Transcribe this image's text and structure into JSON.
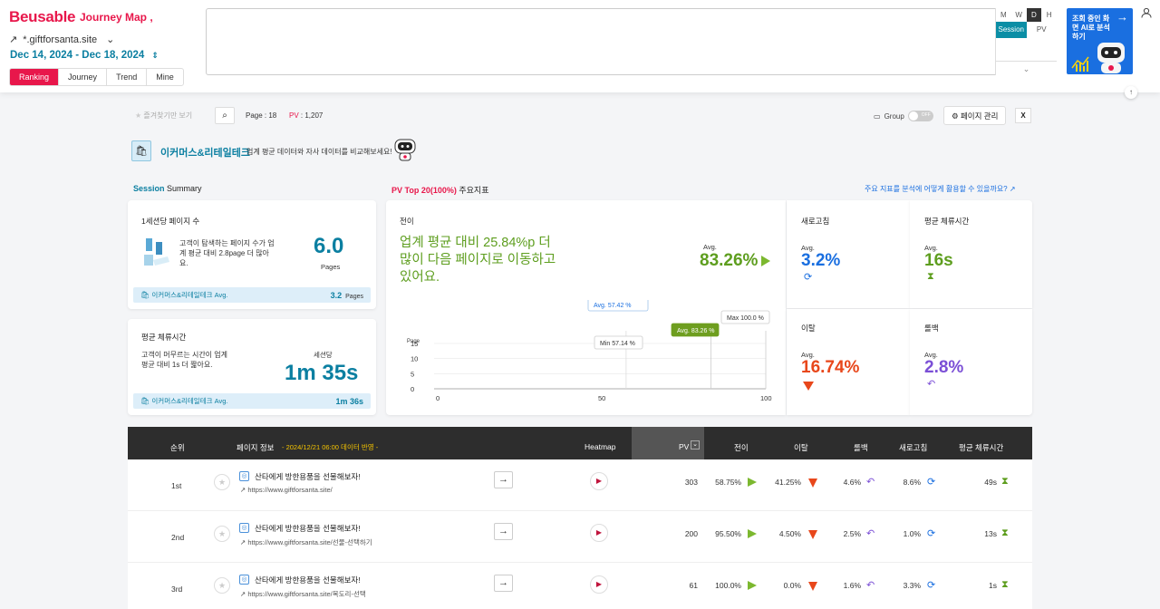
{
  "header": {
    "logo": "Beusable",
    "logo_sub": "Journey Map",
    "site": "*.giftforsanta.site",
    "date_range": "Dec 14, 2024 - Dec 18, 2024",
    "tabs": [
      "Ranking",
      "Journey",
      "Trend",
      "Mine"
    ],
    "granularity": [
      "M",
      "W",
      "D",
      "H"
    ],
    "metrics": [
      "Session",
      "PV"
    ],
    "ai_ad": "조회 중인 화면 AI로 분석하기"
  },
  "toolbar": {
    "favorites": "즐겨찾기만 보기",
    "page": "Page : 18",
    "pv_label": "PV",
    "pv_value": ": 1,207",
    "group": "Group",
    "toggle": "OFF",
    "manage": "페이지 관리",
    "excel": "X"
  },
  "industry": {
    "title": "이커머스&리테일테크",
    "desc": "업계 평균 데이터와 자사 데이터를 비교해보세요!"
  },
  "summary": {
    "label_a": "Session",
    "label_b": "Summary",
    "pv_top_a": "PV Top 20(100%)",
    "pv_top_b": "주요지표",
    "help": "주요 지표를 분석에 어떻게 활용할 수 있을까요?"
  },
  "pages_card": {
    "title": "1세션당 페이지 수",
    "desc": "고객이 탐색하는 페이지 수가 업계 평균 대비 2.8page 더 많아요.",
    "value": "6.0",
    "unit": "Pages",
    "avg_label": "이커머스&리테일테크 Avg.",
    "avg_value": "3.2",
    "avg_unit": "Pages"
  },
  "stay_card": {
    "title": "평균 체류시간",
    "desc": "고객이 머무르는 시간이 업계 평균 대비 1s 더 짧아요.",
    "sublabel": "세션당",
    "value": "1m 35s",
    "avg_label": "이커머스&리테일테크 Avg.",
    "avg_value": "1m 36s"
  },
  "transition": {
    "title": "전이",
    "headline": "업계 평균 대비 25.84%p 더 많이 다음 페이지로 이동하고 있어요.",
    "avg_label": "Avg.",
    "avg_value": "83.26%",
    "tip_avg": "Avg. 57.42 %",
    "tip_avg2": "Avg. 83.26 %",
    "tip_min": "Min 57.14 %",
    "tip_max": "Max 100.0 %"
  },
  "chart_data": {
    "type": "bar",
    "ylabel": "Page",
    "yticks": [
      "15",
      "10",
      "5",
      "0"
    ],
    "xticks": [
      "0",
      "50",
      "100"
    ],
    "ylim": [
      0,
      15
    ],
    "xlim": [
      0,
      100
    ],
    "markers": {
      "industry_avg": 57.42,
      "site_avg": 83.26,
      "min": 57.14,
      "max": 100.0
    }
  },
  "kpis": {
    "refresh": {
      "label": "새로고침",
      "avg": "Avg.",
      "value": "3.2%"
    },
    "stay": {
      "label": "평균 체류시간",
      "avg": "Avg.",
      "value": "16s"
    },
    "exit": {
      "label": "이탈",
      "avg": "Avg.",
      "value": "16.74%"
    },
    "back": {
      "label": "롤백",
      "avg": "Avg.",
      "value": "2.8%"
    }
  },
  "table": {
    "headers": {
      "rank": "순위",
      "page": "페이지 정보",
      "note": "- 2024/12/21 06:00 데이터 반영 -",
      "heatmap": "Heatmap",
      "pv": "PV",
      "trans": "전이",
      "exit": "이탈",
      "back": "롤백",
      "refresh": "새로고침",
      "stay": "평균 체류시간"
    },
    "rows": [
      {
        "rank": "1st",
        "title": "산타에게 방한용품을 선물해보자!",
        "url": "https://www.giftforsanta.site/",
        "pv": "303",
        "trans": "58.75%",
        "exit": "41.25%",
        "back": "4.6%",
        "refresh": "8.6%",
        "stay": "49s"
      },
      {
        "rank": "2nd",
        "title": "산타에게 방한용품을 선물해보자!",
        "url": "https://www.giftforsanta.site/선물-선택하기",
        "pv": "200",
        "trans": "95.50%",
        "exit": "4.50%",
        "back": "2.5%",
        "refresh": "1.0%",
        "stay": "13s"
      },
      {
        "rank": "3rd",
        "title": "산타에게 방한용품을 선물해보자!",
        "url": "https://www.giftforsanta.site/목도리-선택",
        "pv": "61",
        "trans": "100.0%",
        "exit": "0.0%",
        "back": "1.6%",
        "refresh": "3.3%",
        "stay": "1s"
      }
    ]
  },
  "colors": {
    "brand": "#e8174b",
    "teal": "#0b7fa1",
    "green": "#5e9e1f",
    "blue": "#1a6fe0",
    "orange": "#e8471b",
    "purple": "#7b4fd6"
  }
}
